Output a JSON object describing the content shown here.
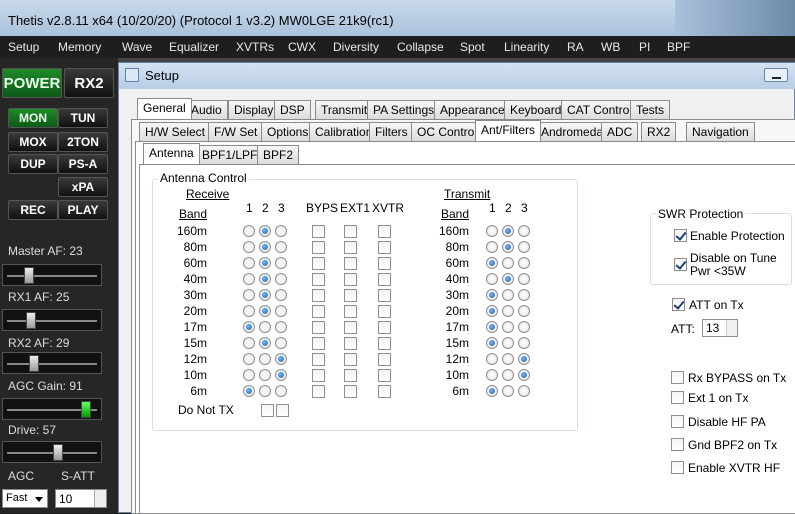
{
  "window": {
    "title": "Thetis v2.8.11 x64 (10/20/20) (Protocol 1 v3.2) MW0LGE 21k9(rc1)"
  },
  "menu": [
    "Setup",
    "Memory",
    "Wave",
    "Equalizer",
    "XVTRs",
    "CWX",
    "Diversity",
    "Collapse",
    "Spot",
    "Linearity",
    "RA",
    "WB",
    "PI",
    "BPF"
  ],
  "left": {
    "power": "POWER",
    "rx2": "RX2",
    "buttons": [
      "MON",
      "TUN",
      "MOX",
      "2TON",
      "DUP",
      "PS-A",
      "xPA",
      "REC",
      "PLAY"
    ],
    "master_af": "Master AF:  23",
    "rx1_af": "RX1 AF:  25",
    "rx2_af": "RX2 AF:  29",
    "agc_gain": "AGC Gain:  91",
    "drive": "Drive:  57",
    "agc_label": "AGC",
    "satt_label": "S-ATT",
    "agc_value": "Fast",
    "satt_value": "10",
    "levels": {
      "master_af": 23,
      "rx1_af": 25,
      "rx2_af": 29,
      "agc_gain": 91,
      "drive": 57
    }
  },
  "setup": {
    "title": "Setup",
    "tabs1": [
      "General",
      "Audio",
      "Display",
      "DSP",
      "Transmit",
      "PA Settings",
      "Appearance",
      "Keyboard",
      "CAT Control",
      "Tests"
    ],
    "tabs2": [
      "H/W Select",
      "F/W Set",
      "Options",
      "Calibration",
      "Filters",
      "OC Control",
      "Ant/Filters",
      "Andromeda",
      "ADC",
      "RX2",
      "Navigation"
    ],
    "tabs3": [
      "Antenna",
      "BPF1/LPF",
      "BPF2"
    ],
    "antenna": {
      "group_title": "Antenna Control",
      "receive": "Receive",
      "transmit": "Transmit",
      "band": "Band",
      "cols": [
        "1",
        "2",
        "3"
      ],
      "extra_cols": [
        "BYPS",
        "EXT1",
        "XVTR"
      ],
      "do_not_tx": "Do Not TX",
      "bands": [
        "160m",
        "80m",
        "60m",
        "40m",
        "30m",
        "20m",
        "17m",
        "15m",
        "12m",
        "10m",
        "6m"
      ],
      "rx_selected": [
        2,
        2,
        2,
        2,
        2,
        2,
        1,
        2,
        3,
        3,
        1
      ],
      "tx_selected": [
        2,
        2,
        1,
        2,
        1,
        1,
        1,
        1,
        3,
        3,
        1
      ]
    },
    "swr": {
      "group_title": "SWR Protection",
      "enable_protection": "Enable Protection",
      "disable_on_tune": "Disable on Tune Pwr <35W"
    },
    "att_on_tx": "ATT on Tx",
    "att_label": "ATT:",
    "att_value": "13",
    "options": [
      "Rx BYPASS on Tx",
      "Ext 1 on Tx",
      "Disable HF PA",
      "Gnd BPF2 on Tx",
      "Enable XVTR HF"
    ]
  }
}
